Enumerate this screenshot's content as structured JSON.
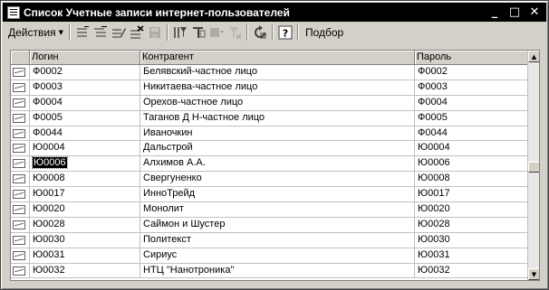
{
  "window": {
    "title": "Список Учетные записи интернет-пользователей",
    "minimize_symbol": "_",
    "maximize_symbol": "□",
    "close_symbol": "✕"
  },
  "toolbar": {
    "actions_label": "Действия",
    "actions_caret": "▼",
    "select_label": "Подбор",
    "icons": [
      "add-icon",
      "add-group-icon",
      "edit-icon",
      "delete-icon",
      "save-icon",
      "filter-icon",
      "filter-set-icon",
      "filter-list-icon",
      "filter-clear-icon",
      "refresh-icon",
      "help-icon"
    ]
  },
  "grid": {
    "columns": [
      "",
      "Логин",
      "Контрагент",
      "Пароль"
    ],
    "rows": [
      {
        "login": "Ф0002",
        "counterparty": "Белявский-частное лицо",
        "password": "Ф0002",
        "selected": false
      },
      {
        "login": "Ф0003",
        "counterparty": "Никитаева-частное лицо",
        "password": "Ф0003",
        "selected": false
      },
      {
        "login": "Ф0004",
        "counterparty": "Орехов-частное лицо",
        "password": "Ф0004",
        "selected": false
      },
      {
        "login": "Ф0005",
        "counterparty": "Таганов Д Н-частное лицо",
        "password": "Ф0005",
        "selected": false
      },
      {
        "login": "Ф0044",
        "counterparty": "Иваночкин",
        "password": "Ф0044",
        "selected": false
      },
      {
        "login": "Ю0004",
        "counterparty": "Дальстрой",
        "password": "Ю0004",
        "selected": false
      },
      {
        "login": "Ю0006",
        "counterparty": "Алхимов А.А.",
        "password": "Ю0006",
        "selected": true
      },
      {
        "login": "Ю0008",
        "counterparty": "Свергуненко",
        "password": "Ю0008",
        "selected": false
      },
      {
        "login": "Ю0017",
        "counterparty": "ИнноТрейд",
        "password": "Ю0017",
        "selected": false
      },
      {
        "login": "Ю0020",
        "counterparty": "Монолит",
        "password": "Ю0020",
        "selected": false
      },
      {
        "login": "Ю0028",
        "counterparty": "Саймон и Шустер",
        "password": "Ю0028",
        "selected": false
      },
      {
        "login": "Ю0030",
        "counterparty": "Политекст",
        "password": "Ю0030",
        "selected": false
      },
      {
        "login": "Ю0031",
        "counterparty": "Сириус",
        "password": "Ю0031",
        "selected": false
      },
      {
        "login": "Ю0032",
        "counterparty": "НТЦ \"Нанотроника\"",
        "password": "Ю0032",
        "selected": false
      }
    ]
  },
  "scrollbar": {
    "up_symbol": "▲",
    "down_symbol": "▼"
  }
}
